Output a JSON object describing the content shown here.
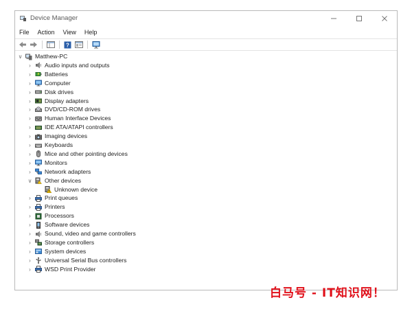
{
  "window": {
    "title": "Device Manager"
  },
  "menu": [
    "File",
    "Action",
    "View",
    "Help"
  ],
  "tree": {
    "root": "Matthew-PC",
    "items": [
      {
        "label": "Audio inputs and outputs",
        "icon": "speaker-icon",
        "expanded": false
      },
      {
        "label": "Batteries",
        "icon": "battery-icon",
        "expanded": false
      },
      {
        "label": "Computer",
        "icon": "monitor-icon",
        "expanded": false
      },
      {
        "label": "Disk drives",
        "icon": "disk-drive-icon",
        "expanded": false
      },
      {
        "label": "Display adapters",
        "icon": "display-adapter-icon",
        "expanded": false
      },
      {
        "label": "DVD/CD-ROM drives",
        "icon": "dvd-drive-icon",
        "expanded": false
      },
      {
        "label": "Human Interface Devices",
        "icon": "hid-icon",
        "expanded": false
      },
      {
        "label": "IDE ATA/ATAPI controllers",
        "icon": "ide-controller-icon",
        "expanded": false
      },
      {
        "label": "Imaging devices",
        "icon": "camera-icon",
        "expanded": false
      },
      {
        "label": "Keyboards",
        "icon": "keyboard-icon",
        "expanded": false
      },
      {
        "label": "Mice and other pointing devices",
        "icon": "mouse-icon",
        "expanded": false
      },
      {
        "label": "Monitors",
        "icon": "monitor-icon",
        "expanded": false
      },
      {
        "label": "Network adapters",
        "icon": "network-adapter-icon",
        "expanded": false
      },
      {
        "label": "Other devices",
        "icon": "other-devices-icon",
        "expanded": true,
        "children": [
          {
            "label": "Unknown device",
            "icon": "unknown-device-warning-icon"
          }
        ]
      },
      {
        "label": "Print queues",
        "icon": "printer-icon",
        "expanded": false
      },
      {
        "label": "Printers",
        "icon": "printer-icon",
        "expanded": false
      },
      {
        "label": "Processors",
        "icon": "processor-icon",
        "expanded": false
      },
      {
        "label": "Software devices",
        "icon": "software-device-icon",
        "expanded": false
      },
      {
        "label": "Sound, video and game controllers",
        "icon": "speaker-icon",
        "expanded": false
      },
      {
        "label": "Storage controllers",
        "icon": "storage-controller-icon",
        "expanded": false
      },
      {
        "label": "System devices",
        "icon": "system-device-icon",
        "expanded": false
      },
      {
        "label": "Universal Serial Bus controllers",
        "icon": "usb-icon",
        "expanded": false
      },
      {
        "label": "WSD Print Provider",
        "icon": "printer-icon",
        "expanded": false
      }
    ]
  },
  "watermark": "白马号 - IT知识网！",
  "colors": {
    "accent": "#1a73c8",
    "warning": "#e8b400",
    "watermark": "#e0101a"
  }
}
